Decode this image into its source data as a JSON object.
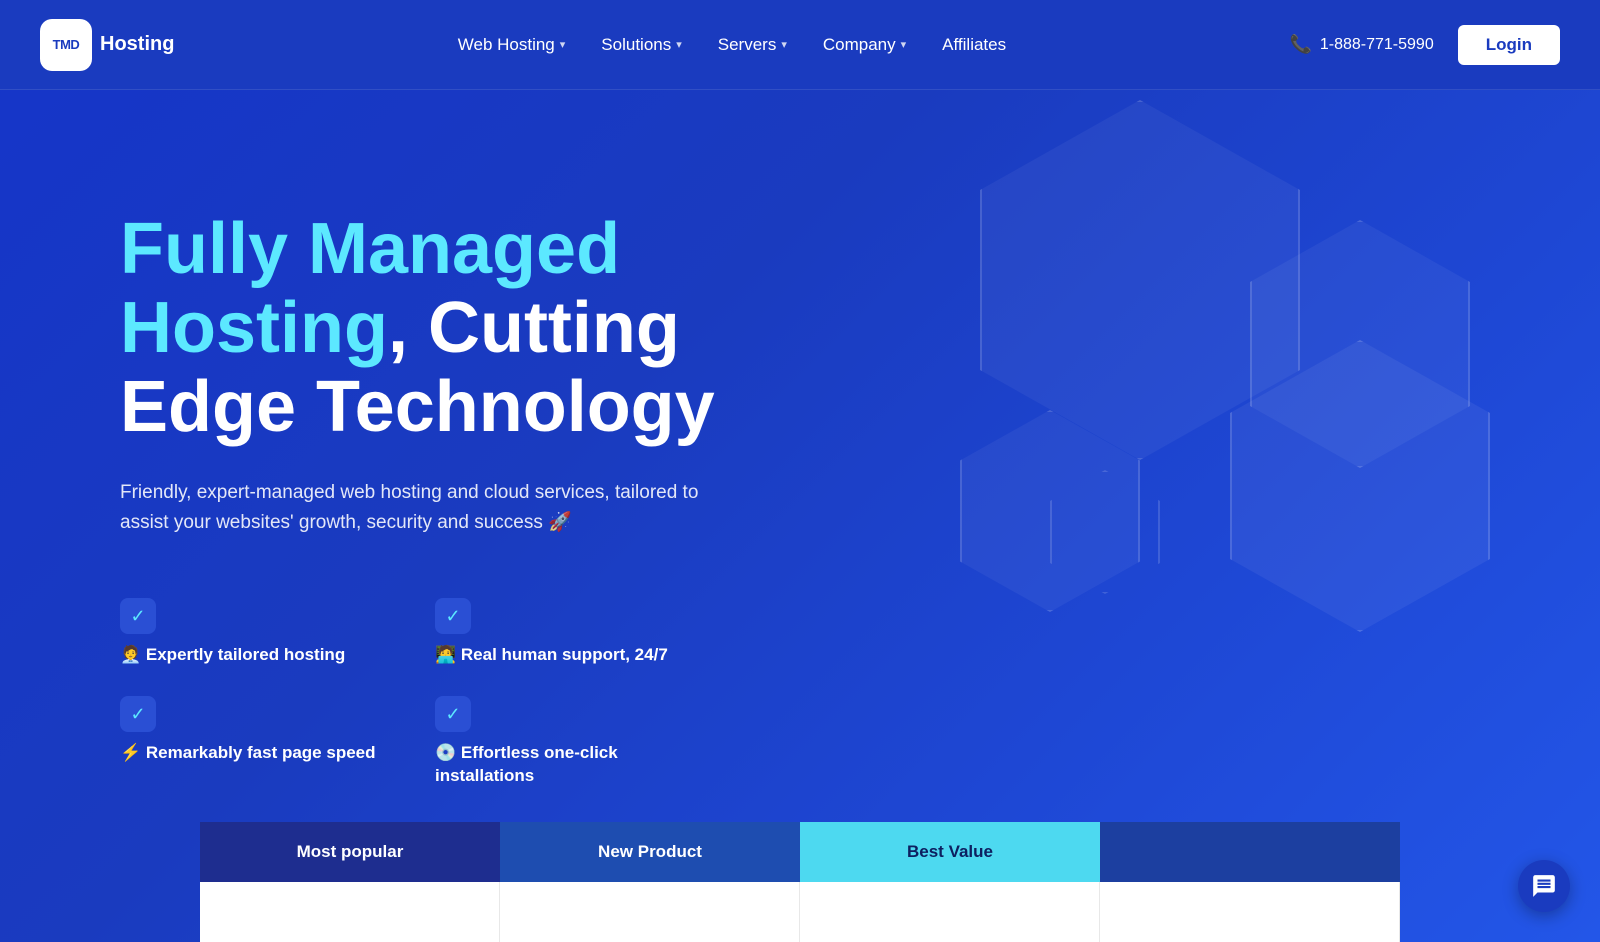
{
  "header": {
    "logo_badge": "TMD",
    "logo_text": "Hosting",
    "nav": [
      {
        "label": "Web Hosting",
        "has_dropdown": true
      },
      {
        "label": "Solutions",
        "has_dropdown": true
      },
      {
        "label": "Servers",
        "has_dropdown": true
      },
      {
        "label": "Company",
        "has_dropdown": true
      },
      {
        "label": "Affiliates",
        "has_dropdown": false
      }
    ],
    "phone": "1-888-771-5990",
    "login_label": "Login"
  },
  "hero": {
    "title_part1": "Fully Managed",
    "title_part2": "Hosting",
    "title_part3": ", Cutting Edge Technology",
    "subtitle": "Friendly, expert-managed web hosting and cloud services, tailored to assist your websites' growth, security and success 🚀",
    "features": [
      {
        "emoji": "🧑‍💼",
        "label": "Expertly tailored hosting"
      },
      {
        "emoji": "🧑‍💻",
        "label": "Real human support, 24/7"
      },
      {
        "emoji": "⚡",
        "label": "Remarkably fast page speed"
      },
      {
        "emoji": "💿",
        "label": "Effortless one-click installations"
      }
    ]
  },
  "tabs": [
    {
      "label": "Most popular",
      "type": "most-popular"
    },
    {
      "label": "New Product",
      "type": "new-product"
    },
    {
      "label": "Best Value",
      "type": "best-value"
    },
    {
      "label": "",
      "type": "fourth"
    }
  ]
}
